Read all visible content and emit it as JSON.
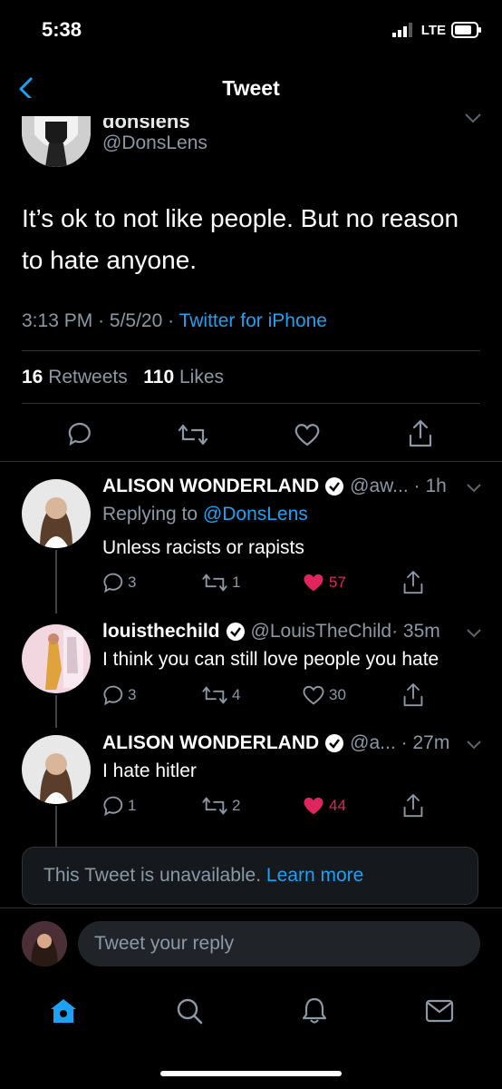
{
  "status": {
    "time": "5:38",
    "network": "LTE"
  },
  "nav": {
    "title": "Tweet"
  },
  "main_tweet": {
    "display_name": "donslens",
    "handle": "@DonsLens",
    "text": "It’s ok to not like people.  But no reason to hate anyone.",
    "time": "3:13 PM",
    "date": "5/5/20",
    "source": "Twitter for iPhone",
    "retweets_count": "16",
    "retweets_label": "Retweets",
    "likes_count": "110",
    "likes_label": "Likes"
  },
  "replies": [
    {
      "name": "ALISON WONDERLAND",
      "handle": "@aw...",
      "time": "· 1h",
      "replying_prefix": "Replying to",
      "replying_to": "@DonsLens",
      "text": "Unless racists or rapists",
      "replies": "3",
      "retweets": "1",
      "likes": "57",
      "liked": true
    },
    {
      "name": "louisthechild",
      "handle": "@LouisTheChild",
      "time": "· 35m",
      "text": "I think you can still love people you hate",
      "replies": "3",
      "retweets": "4",
      "likes": "30",
      "liked": false
    },
    {
      "name": "ALISON WONDERLAND",
      "handle": "@a...",
      "time": "· 27m",
      "text": "I hate hitler",
      "replies": "1",
      "retweets": "2",
      "likes": "44",
      "liked": true
    }
  ],
  "unavailable": {
    "text": "This Tweet is unavailable.",
    "link": "Learn more"
  },
  "reply_bar": {
    "placeholder": "Tweet your reply"
  },
  "colors": {
    "accent": "#1da1f2",
    "like": "#e0245e",
    "background": "#000000",
    "secondary_text": "#8b98a5"
  },
  "tabs": [
    "home-icon",
    "search-icon",
    "notifications-icon",
    "messages-icon"
  ]
}
